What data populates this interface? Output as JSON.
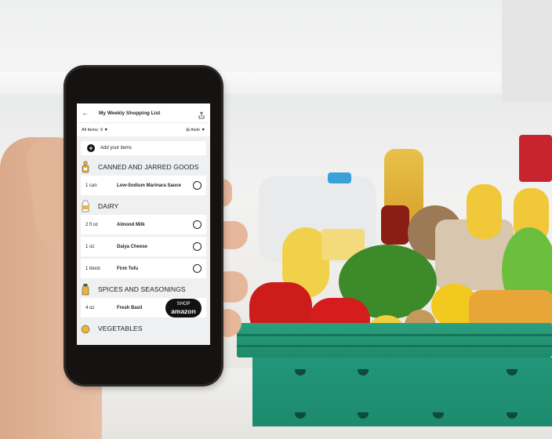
{
  "app": {
    "title": "My Weekly Shopping List",
    "back_icon": "arrow-left-icon",
    "share_icon": "share-icon"
  },
  "filters": {
    "all_items_label": "All items: 9",
    "sort_label": "Aisle",
    "sort_icon": "grid-icon",
    "dropdown_icon": "caret-down-icon"
  },
  "add_items": {
    "label": "Add your items",
    "icon": "plus-circle-icon"
  },
  "categories": [
    {
      "name": "CANNED AND JARRED GOODS",
      "icon": "jar-icon",
      "items": [
        {
          "qty": "1 can",
          "name": "Low-Sodium Marinara Sauce",
          "checked": false
        }
      ]
    },
    {
      "name": "DAIRY",
      "icon": "milk-carton-icon",
      "items": [
        {
          "qty": "2 fl oz",
          "name": "Almond Milk",
          "checked": false
        },
        {
          "qty": "1 oz",
          "name": "Daiya Cheese",
          "checked": false
        },
        {
          "qty": "1 block",
          "name": "Firm Tofu",
          "checked": false
        }
      ]
    },
    {
      "name": "SPICES AND SEASONINGS",
      "icon": "spice-shaker-icon",
      "items": [
        {
          "qty": "4 oz",
          "name": "Fresh Basil",
          "checked": false
        }
      ]
    },
    {
      "name": "VEGETABLES",
      "icon": "vegetables-icon",
      "items": []
    }
  ],
  "shop_button": {
    "line1": "SHOP",
    "line2": "amazon"
  },
  "colors": {
    "accent_icon": "#e8b43a",
    "crate_green": "#1f8f70",
    "shop_button_bg": "#111111"
  }
}
